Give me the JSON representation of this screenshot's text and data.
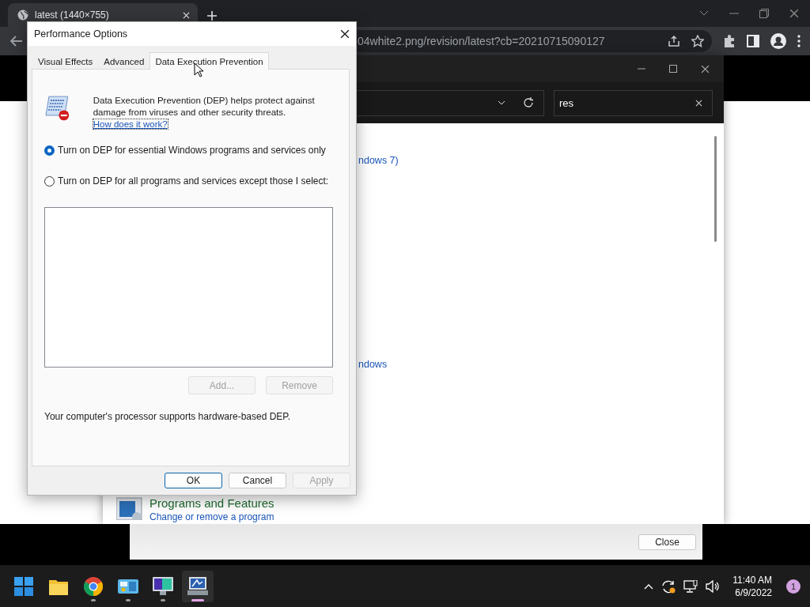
{
  "browser": {
    "tab": {
      "title": "latest (1440×755)"
    },
    "address": "04white2.png/revision/latest?cb=20210715090127"
  },
  "control_panel": {
    "search": {
      "value": "res"
    },
    "links": [
      "ndows 7)",
      "ndows"
    ],
    "result": {
      "title": "Programs and Features",
      "subtitle": "Change or remove a program"
    }
  },
  "background_window": {
    "button": "Close"
  },
  "dialog": {
    "title": "Performance Options",
    "tabs": [
      {
        "label": "Visual Effects",
        "selected": false
      },
      {
        "label": "Advanced",
        "selected": false
      },
      {
        "label": "Data Execution Prevention",
        "selected": true
      }
    ],
    "description": "Data Execution Prevention (DEP) helps protect against damage from viruses and other security threats.",
    "link": "How does it work?",
    "options": [
      {
        "label": "Turn on DEP for essential Windows programs and services only",
        "selected": true
      },
      {
        "label": "Turn on DEP for all programs and services except those I select:",
        "selected": false
      }
    ],
    "list_buttons": [
      {
        "label": "Add...",
        "disabled": true
      },
      {
        "label": "Remove",
        "disabled": true
      }
    ],
    "status": "Your computer's processor supports hardware-based DEP.",
    "buttons": [
      {
        "label": "OK",
        "disabled": false
      },
      {
        "label": "Cancel",
        "disabled": false
      },
      {
        "label": "Apply",
        "disabled": true
      }
    ]
  },
  "taskbar": {
    "apps": [
      {
        "kind": "start",
        "running": false,
        "active": false
      },
      {
        "kind": "folder",
        "running": false,
        "active": false
      },
      {
        "kind": "browser",
        "running": true,
        "active": false
      },
      {
        "kind": "control",
        "running": true,
        "active": false
      },
      {
        "kind": "monitor",
        "running": true,
        "active": false
      },
      {
        "kind": "performance",
        "running": true,
        "active": true
      }
    ],
    "clock": {
      "time": "11:40 AM",
      "date": "6/9/2022"
    },
    "notifications": "1"
  }
}
